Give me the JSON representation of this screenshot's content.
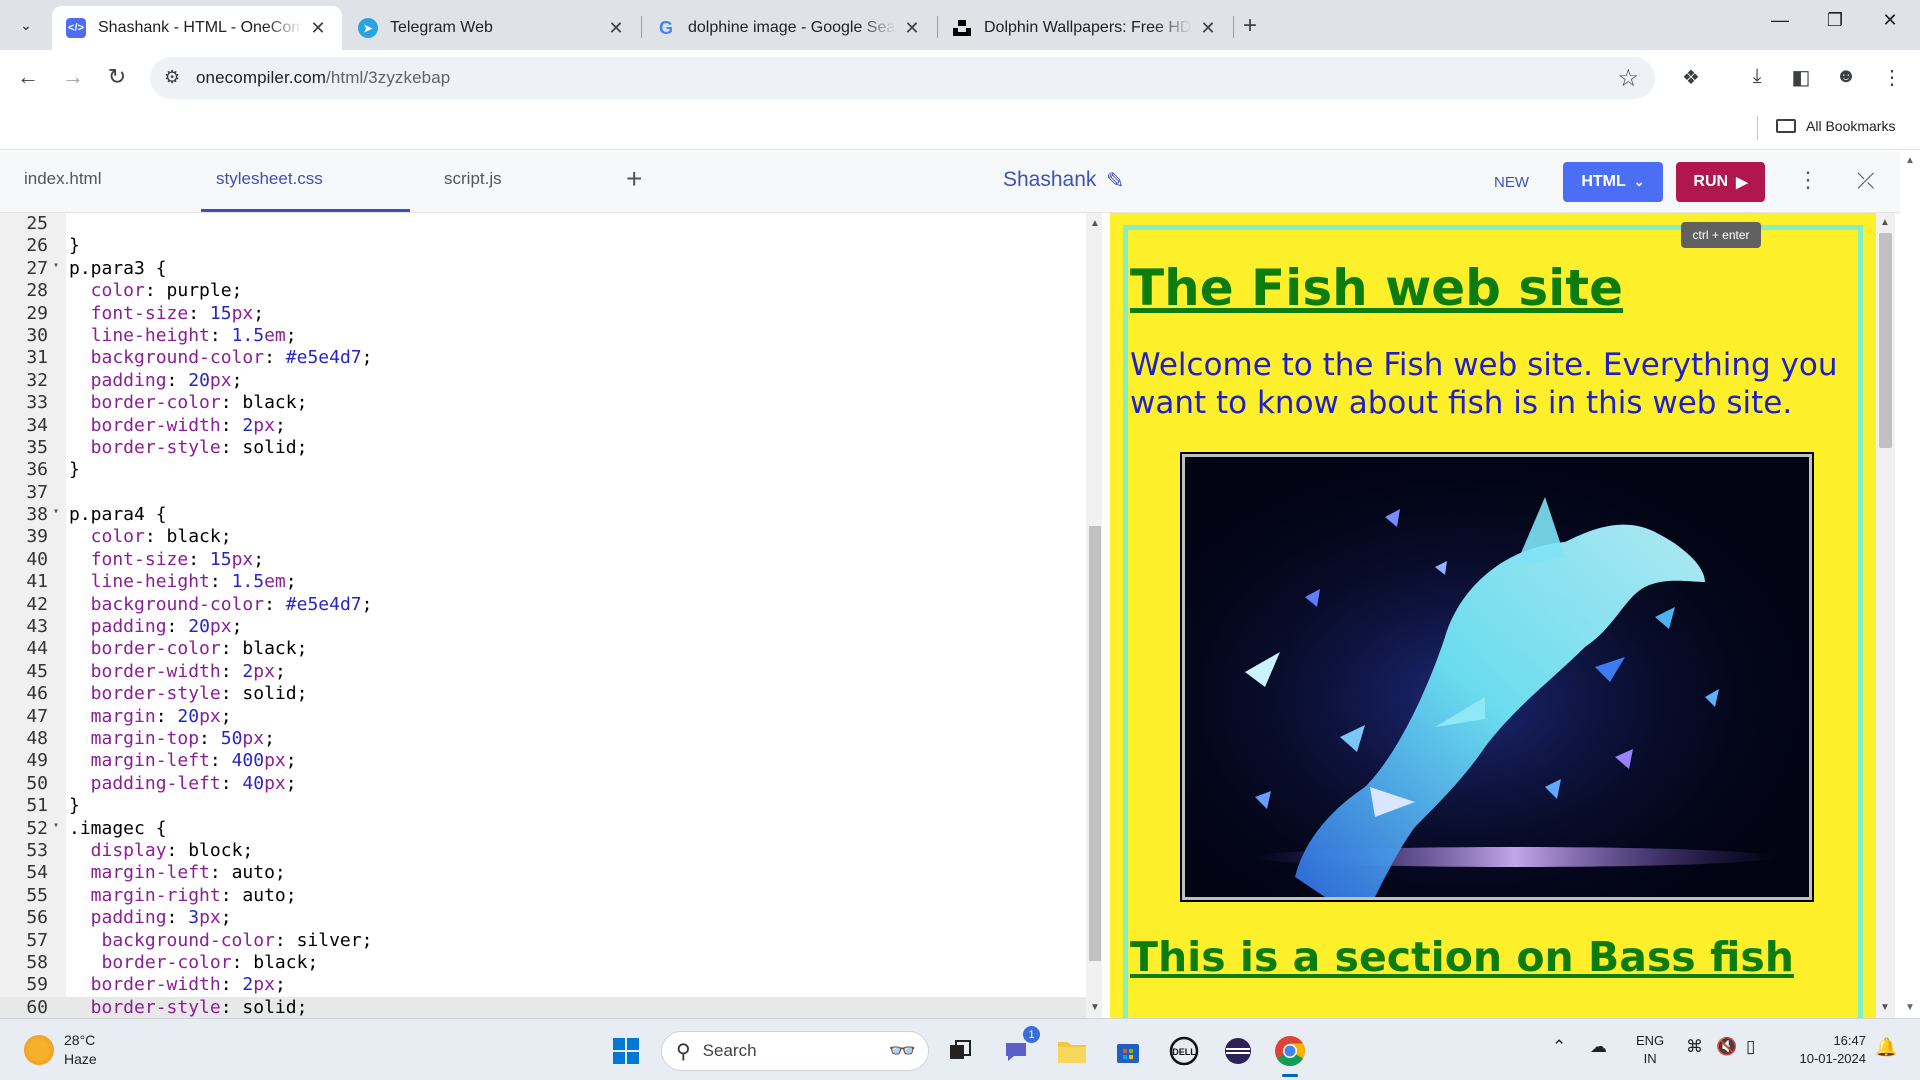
{
  "browser": {
    "tabs": [
      {
        "title": "Shashank - HTML - OneCompiler",
        "favicon": "onecompiler-icon",
        "active": true
      },
      {
        "title": "Telegram Web",
        "favicon": "telegram-icon",
        "active": false
      },
      {
        "title": "dolphine image - Google Search",
        "favicon": "google-icon",
        "active": false
      },
      {
        "title": "Dolphin Wallpapers: Free HD Download",
        "favicon": "unsplash-icon",
        "active": false
      }
    ],
    "address": {
      "host": "onecompiler.com",
      "path": "/html/3zyzkebap"
    },
    "bookmarks": {
      "all_label": "All Bookmarks"
    }
  },
  "editor": {
    "file_tabs": [
      {
        "label": "index.html"
      },
      {
        "label": "stylesheet.css"
      },
      {
        "label": "script.js"
      }
    ],
    "active_file": "stylesheet.css",
    "project_name": "Shashank",
    "buttons": {
      "new": "NEW",
      "language": "HTML",
      "run": "RUN",
      "run_tooltip": "ctrl + enter"
    },
    "lines": [
      {
        "n": "25",
        "fold": false,
        "tokens": []
      },
      {
        "n": "26",
        "fold": false,
        "tokens": [
          {
            "t": "}",
            "k": "s"
          }
        ]
      },
      {
        "n": "27",
        "fold": true,
        "tokens": [
          {
            "t": "p.para3 {",
            "k": "s"
          }
        ]
      },
      {
        "n": "28",
        "fold": false,
        "tokens": [
          {
            "t": "  color",
            "k": "p"
          },
          {
            "t": ": purple;",
            "k": "s"
          }
        ]
      },
      {
        "n": "29",
        "fold": false,
        "tokens": [
          {
            "t": "  font-size",
            "k": "p"
          },
          {
            "t": ": ",
            "k": "s"
          },
          {
            "t": "15",
            "k": "n"
          },
          {
            "t": "px",
            "k": "u"
          },
          {
            "t": ";",
            "k": "s"
          }
        ]
      },
      {
        "n": "30",
        "fold": false,
        "tokens": [
          {
            "t": "  line-height",
            "k": "p"
          },
          {
            "t": ": ",
            "k": "s"
          },
          {
            "t": "1.5",
            "k": "n"
          },
          {
            "t": "em",
            "k": "u"
          },
          {
            "t": ";",
            "k": "s"
          }
        ]
      },
      {
        "n": "31",
        "fold": false,
        "tokens": [
          {
            "t": "  background-color",
            "k": "p"
          },
          {
            "t": ": ",
            "k": "s"
          },
          {
            "t": "#e5e4d7",
            "k": "n"
          },
          {
            "t": ";",
            "k": "s"
          }
        ]
      },
      {
        "n": "32",
        "fold": false,
        "tokens": [
          {
            "t": "  padding",
            "k": "p"
          },
          {
            "t": ": ",
            "k": "s"
          },
          {
            "t": "20",
            "k": "n"
          },
          {
            "t": "px",
            "k": "u"
          },
          {
            "t": ";",
            "k": "s"
          }
        ]
      },
      {
        "n": "33",
        "fold": false,
        "tokens": [
          {
            "t": "  border-color",
            "k": "p"
          },
          {
            "t": ": black;",
            "k": "s"
          }
        ]
      },
      {
        "n": "34",
        "fold": false,
        "tokens": [
          {
            "t": "  border-width",
            "k": "p"
          },
          {
            "t": ": ",
            "k": "s"
          },
          {
            "t": "2",
            "k": "n"
          },
          {
            "t": "px",
            "k": "u"
          },
          {
            "t": ";",
            "k": "s"
          }
        ]
      },
      {
        "n": "35",
        "fold": false,
        "tokens": [
          {
            "t": "  border-style",
            "k": "p"
          },
          {
            "t": ": solid;",
            "k": "s"
          }
        ]
      },
      {
        "n": "36",
        "fold": false,
        "tokens": [
          {
            "t": "}",
            "k": "s"
          }
        ]
      },
      {
        "n": "37",
        "fold": false,
        "tokens": []
      },
      {
        "n": "38",
        "fold": true,
        "tokens": [
          {
            "t": "p.para4 {",
            "k": "s"
          }
        ]
      },
      {
        "n": "39",
        "fold": false,
        "tokens": [
          {
            "t": "  color",
            "k": "p"
          },
          {
            "t": ": black;",
            "k": "s"
          }
        ]
      },
      {
        "n": "40",
        "fold": false,
        "tokens": [
          {
            "t": "  font-size",
            "k": "p"
          },
          {
            "t": ": ",
            "k": "s"
          },
          {
            "t": "15",
            "k": "n"
          },
          {
            "t": "px",
            "k": "u"
          },
          {
            "t": ";",
            "k": "s"
          }
        ]
      },
      {
        "n": "41",
        "fold": false,
        "tokens": [
          {
            "t": "  line-height",
            "k": "p"
          },
          {
            "t": ": ",
            "k": "s"
          },
          {
            "t": "1.5",
            "k": "n"
          },
          {
            "t": "em",
            "k": "u"
          },
          {
            "t": ";",
            "k": "s"
          }
        ]
      },
      {
        "n": "42",
        "fold": false,
        "tokens": [
          {
            "t": "  background-color",
            "k": "p"
          },
          {
            "t": ": ",
            "k": "s"
          },
          {
            "t": "#e5e4d7",
            "k": "n"
          },
          {
            "t": ";",
            "k": "s"
          }
        ]
      },
      {
        "n": "43",
        "fold": false,
        "tokens": [
          {
            "t": "  padding",
            "k": "p"
          },
          {
            "t": ": ",
            "k": "s"
          },
          {
            "t": "20",
            "k": "n"
          },
          {
            "t": "px",
            "k": "u"
          },
          {
            "t": ";",
            "k": "s"
          }
        ]
      },
      {
        "n": "44",
        "fold": false,
        "tokens": [
          {
            "t": "  border-color",
            "k": "p"
          },
          {
            "t": ": black;",
            "k": "s"
          }
        ]
      },
      {
        "n": "45",
        "fold": false,
        "tokens": [
          {
            "t": "  border-width",
            "k": "p"
          },
          {
            "t": ": ",
            "k": "s"
          },
          {
            "t": "2",
            "k": "n"
          },
          {
            "t": "px",
            "k": "u"
          },
          {
            "t": ";",
            "k": "s"
          }
        ]
      },
      {
        "n": "46",
        "fold": false,
        "tokens": [
          {
            "t": "  border-style",
            "k": "p"
          },
          {
            "t": ": solid;",
            "k": "s"
          }
        ]
      },
      {
        "n": "47",
        "fold": false,
        "tokens": [
          {
            "t": "  margin",
            "k": "p"
          },
          {
            "t": ": ",
            "k": "s"
          },
          {
            "t": "20",
            "k": "n"
          },
          {
            "t": "px",
            "k": "u"
          },
          {
            "t": ";",
            "k": "s"
          }
        ]
      },
      {
        "n": "48",
        "fold": false,
        "tokens": [
          {
            "t": "  margin-top",
            "k": "p"
          },
          {
            "t": ": ",
            "k": "s"
          },
          {
            "t": "50",
            "k": "n"
          },
          {
            "t": "px",
            "k": "u"
          },
          {
            "t": ";",
            "k": "s"
          }
        ]
      },
      {
        "n": "49",
        "fold": false,
        "tokens": [
          {
            "t": "  margin-left",
            "k": "p"
          },
          {
            "t": ": ",
            "k": "s"
          },
          {
            "t": "400",
            "k": "n"
          },
          {
            "t": "px",
            "k": "u"
          },
          {
            "t": ";",
            "k": "s"
          }
        ]
      },
      {
        "n": "50",
        "fold": false,
        "tokens": [
          {
            "t": "  padding-left",
            "k": "p"
          },
          {
            "t": ": ",
            "k": "s"
          },
          {
            "t": "40",
            "k": "n"
          },
          {
            "t": "px",
            "k": "u"
          },
          {
            "t": ";",
            "k": "s"
          }
        ]
      },
      {
        "n": "51",
        "fold": false,
        "tokens": [
          {
            "t": "}",
            "k": "s"
          }
        ]
      },
      {
        "n": "52",
        "fold": true,
        "tokens": [
          {
            "t": ".imagec {",
            "k": "s"
          }
        ]
      },
      {
        "n": "53",
        "fold": false,
        "tokens": [
          {
            "t": "  display",
            "k": "p"
          },
          {
            "t": ": block;",
            "k": "s"
          }
        ]
      },
      {
        "n": "54",
        "fold": false,
        "tokens": [
          {
            "t": "  margin-left",
            "k": "p"
          },
          {
            "t": ": auto;",
            "k": "s"
          }
        ]
      },
      {
        "n": "55",
        "fold": false,
        "tokens": [
          {
            "t": "  margin-right",
            "k": "p"
          },
          {
            "t": ": auto;",
            "k": "s"
          }
        ]
      },
      {
        "n": "56",
        "fold": false,
        "tokens": [
          {
            "t": "  padding",
            "k": "p"
          },
          {
            "t": ": ",
            "k": "s"
          },
          {
            "t": "3",
            "k": "n"
          },
          {
            "t": "px",
            "k": "u"
          },
          {
            "t": ";",
            "k": "s"
          }
        ]
      },
      {
        "n": "57",
        "fold": false,
        "tokens": [
          {
            "t": "   background-color",
            "k": "p"
          },
          {
            "t": ": silver;",
            "k": "s"
          }
        ]
      },
      {
        "n": "58",
        "fold": false,
        "tokens": [
          {
            "t": "   border-color",
            "k": "p"
          },
          {
            "t": ": black;",
            "k": "s"
          }
        ]
      },
      {
        "n": "59",
        "fold": false,
        "tokens": [
          {
            "t": "  border-width",
            "k": "p"
          },
          {
            "t": ": ",
            "k": "s"
          },
          {
            "t": "2",
            "k": "n"
          },
          {
            "t": "px",
            "k": "u"
          },
          {
            "t": ";",
            "k": "s"
          }
        ]
      },
      {
        "n": "60",
        "fold": false,
        "current": true,
        "tokens": [
          {
            "t": "  border-style",
            "k": "p"
          },
          {
            "t": ": solid;",
            "k": "s"
          }
        ]
      }
    ]
  },
  "preview": {
    "heading": "The Fish web site",
    "intro": "Welcome to the Fish web site. Everything you want to know about fish is in this web site.",
    "section_heading": "This is a section on Bass fish",
    "image_subject": "dolphin",
    "colors": {
      "background": "#fdf02a",
      "border": "#7ff0c8",
      "heading": "#0c7d0c",
      "text": "#2020c8"
    }
  },
  "taskbar": {
    "weather": {
      "temp": "28°C",
      "condition": "Haze"
    },
    "search_label": "Search",
    "chat_badge": "1",
    "language": {
      "line1": "ENG",
      "line2": "IN"
    },
    "clock": {
      "time": "16:47",
      "date": "10-01-2024"
    }
  }
}
